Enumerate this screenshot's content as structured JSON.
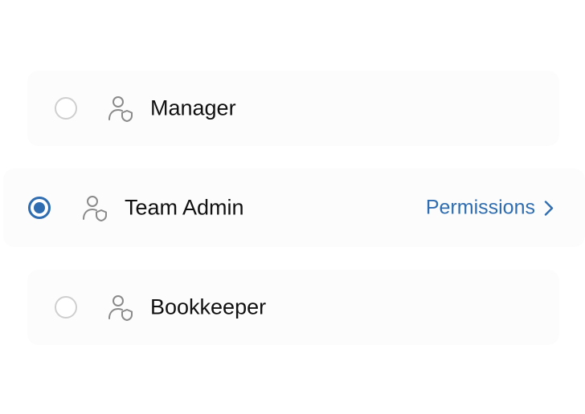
{
  "roles": [
    {
      "label": "Manager",
      "selected": false,
      "icon": "user-shield-icon"
    },
    {
      "label": "Team Admin",
      "selected": true,
      "icon": "user-shield-icon",
      "link_label": "Permissions"
    },
    {
      "label": "Bookkeeper",
      "selected": false,
      "icon": "user-shield-icon"
    }
  ],
  "colors": {
    "accent": "#2f6db0",
    "row_background": "#fcfcfc",
    "radio_border": "#cfcfcf",
    "icon": "#8a8a8a"
  }
}
